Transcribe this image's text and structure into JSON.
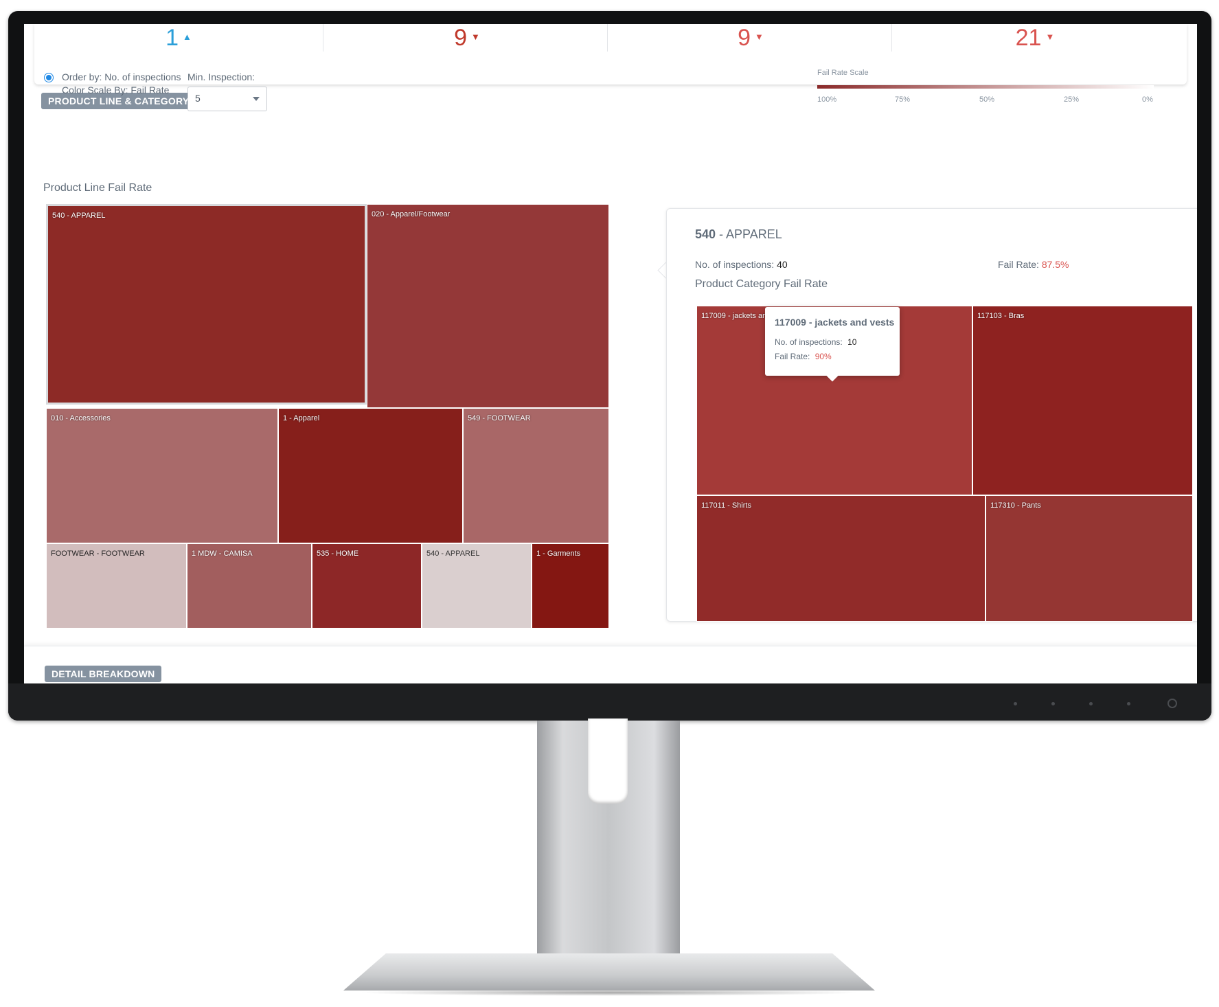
{
  "kpis": [
    {
      "value": "1",
      "arrow": "▲",
      "color": "#2b9fd9"
    },
    {
      "value": "9",
      "arrow": "▼",
      "color": "#c0392b"
    },
    {
      "value": "9",
      "arrow": "▼",
      "color": "#d9534f"
    },
    {
      "value": "21",
      "arrow": "▼",
      "color": "#d9534f"
    }
  ],
  "summary": {
    "section_label": "PRODUCT LINE & CATEGORY SUMMARY",
    "order_by": "Order by: No. of inspections",
    "color_scale_by": "Color Scale By: Fail Rate",
    "min_inspection_label": "Min. Inspection:",
    "min_inspection_value": "5",
    "fail_rate_scale_title": "Fail Rate Scale",
    "fail_rate_scale_ticks": [
      "100%",
      "75%",
      "50%",
      "25%",
      "0%"
    ],
    "product_line_title": "Product Line Fail Rate"
  },
  "product_lines": [
    {
      "label": "540 - APPAREL",
      "color": "#8d2a26",
      "selected": true
    },
    {
      "label": "020 - Apparel/Footwear",
      "color": "#943838"
    },
    {
      "label": "010 - Accessories",
      "color": "#a96a6a"
    },
    {
      "label": "1 - Apparel",
      "color": "#861f1b"
    },
    {
      "label": "549 - FOOTWEAR",
      "color": "#a96767"
    },
    {
      "label": "FOOTWEAR - FOOTWEAR",
      "color": "#d2bdbd"
    },
    {
      "label": "1 MDW - CAMISA",
      "color": "#a25e5e"
    },
    {
      "label": "535 - HOME",
      "color": "#8d2727"
    },
    {
      "label": "540 - APPAREL",
      "color": "#dacfcf"
    },
    {
      "label": "1 - Garments",
      "color": "#841712"
    }
  ],
  "detail": {
    "title_code": "540",
    "title_name": " - APPAREL",
    "inspections_label": "No. of inspections:",
    "inspections_value": "40",
    "fail_rate_label": "Fail Rate:",
    "fail_rate_value": "87.5%",
    "category_title": "Product Category Fail Rate",
    "categories": [
      {
        "label": "117009 - jackets and vests",
        "color": "#a43a38"
      },
      {
        "label": "117103 - Bras",
        "color": "#8e2220"
      },
      {
        "label": "117011 - Shirts",
        "color": "#912b29"
      },
      {
        "label": "117310 - Pants",
        "color": "#953633"
      }
    ],
    "tooltip": {
      "title": "117009 - jackets and vests",
      "inspections_label": "No. of inspections:",
      "inspections_value": "10",
      "fail_rate_label": "Fail Rate:",
      "fail_rate_value": "90%"
    }
  },
  "detail_breakdown": {
    "section_label": "DETAIL BREAKDOWN"
  }
}
